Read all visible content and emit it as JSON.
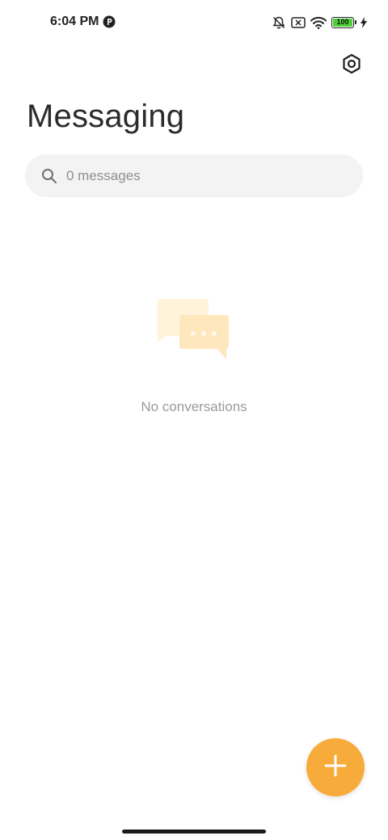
{
  "status_bar": {
    "time": "6:04 PM",
    "app_icon": "notification-app-icon",
    "icons": [
      "notifications-off-icon",
      "sim-x-icon",
      "wifi-icon",
      "battery-icon",
      "charging-bolt-icon"
    ],
    "battery_level": "100",
    "battery_color": "#4cd137"
  },
  "header": {
    "settings_icon": "settings-hexagon-icon",
    "title": "Messaging"
  },
  "search": {
    "icon": "search-icon",
    "placeholder": "0 messages"
  },
  "empty_state": {
    "icon": "chat-bubbles-icon",
    "message": "No conversations"
  },
  "fab": {
    "icon": "plus-icon",
    "color": "#f7ab3a"
  },
  "colors": {
    "accent": "#f7ab3a",
    "search_bg": "#f3f3f3",
    "illustration_light": "#fff3dc",
    "illustration_mid": "#ffe7bd"
  }
}
